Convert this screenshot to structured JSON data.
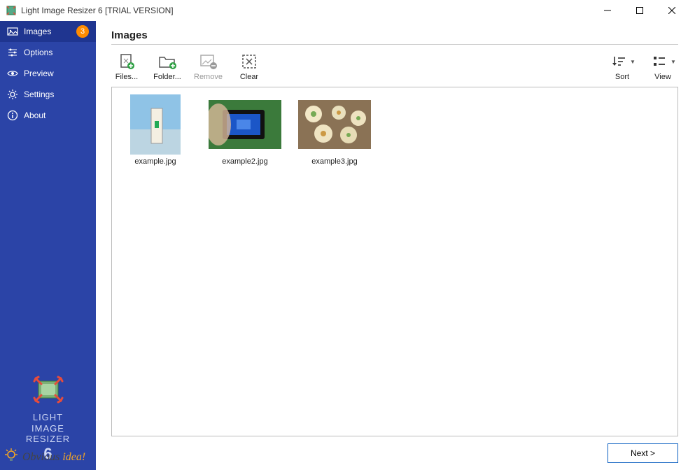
{
  "window": {
    "title": "Light Image Resizer 6  [TRIAL VERSION]"
  },
  "sidebar": {
    "items": [
      {
        "label": "Images",
        "badge": "3",
        "active": true
      },
      {
        "label": "Options"
      },
      {
        "label": "Preview"
      },
      {
        "label": "Settings"
      },
      {
        "label": "About"
      }
    ],
    "logo": {
      "line1": "LIGHT",
      "line2": "IMAGE",
      "line3": "RESIZER",
      "six": "6"
    }
  },
  "page": {
    "title": "Images"
  },
  "toolbar": {
    "files": "Files...",
    "folder": "Folder...",
    "remove": "Remove",
    "clear": "Clear",
    "sort": "Sort",
    "view": "View"
  },
  "thumbs": [
    {
      "name": "example.jpg"
    },
    {
      "name": "example2.jpg"
    },
    {
      "name": "example3.jpg"
    }
  ],
  "next": "Next >",
  "brand": {
    "a": "Obvious",
    "b": "idea!"
  }
}
